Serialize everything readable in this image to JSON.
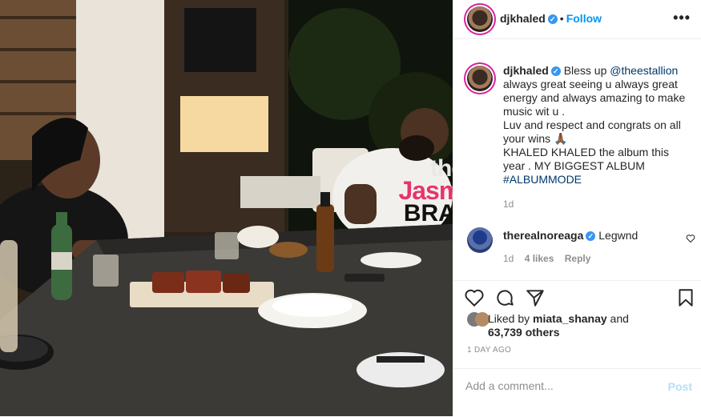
{
  "header": {
    "username": "djkhaled",
    "follow_label": "Follow",
    "dot": "•",
    "more": "•••"
  },
  "caption": {
    "username": "djkhaled",
    "text_before": "Bless up ",
    "mention": "@theestallion",
    "text_after": " always great seeing u always great energy and always amazing to make music wit u .",
    "line2": "Luv and respect and congrats on all your wins 🙏🏾",
    "line3": "KHALED KHALED the album this year . MY BIGGEST ALBUM",
    "hashtag": "#ALBUMMODE",
    "time": "1d"
  },
  "comment": {
    "username": "therealnoreaga",
    "text": "Legwnd",
    "time": "1d",
    "likes": "4 likes",
    "reply": "Reply"
  },
  "likes": {
    "prefix": "Liked by ",
    "user": "miata_shanay",
    "middle": " and",
    "count": "63,739 others"
  },
  "timestamp": "1 DAY AGO",
  "add_comment": {
    "placeholder": "Add a comment...",
    "post_label": "Post"
  },
  "watermark": {
    "the": "the",
    "jasmine": "Jasmine",
    "brand": "BRAND"
  },
  "colors": {
    "accent": "#0095f6",
    "mention": "#00376b",
    "muted": "#8e8e8e",
    "post_disabled": "#b2dffc",
    "watermark_pink": "#e6356b"
  }
}
